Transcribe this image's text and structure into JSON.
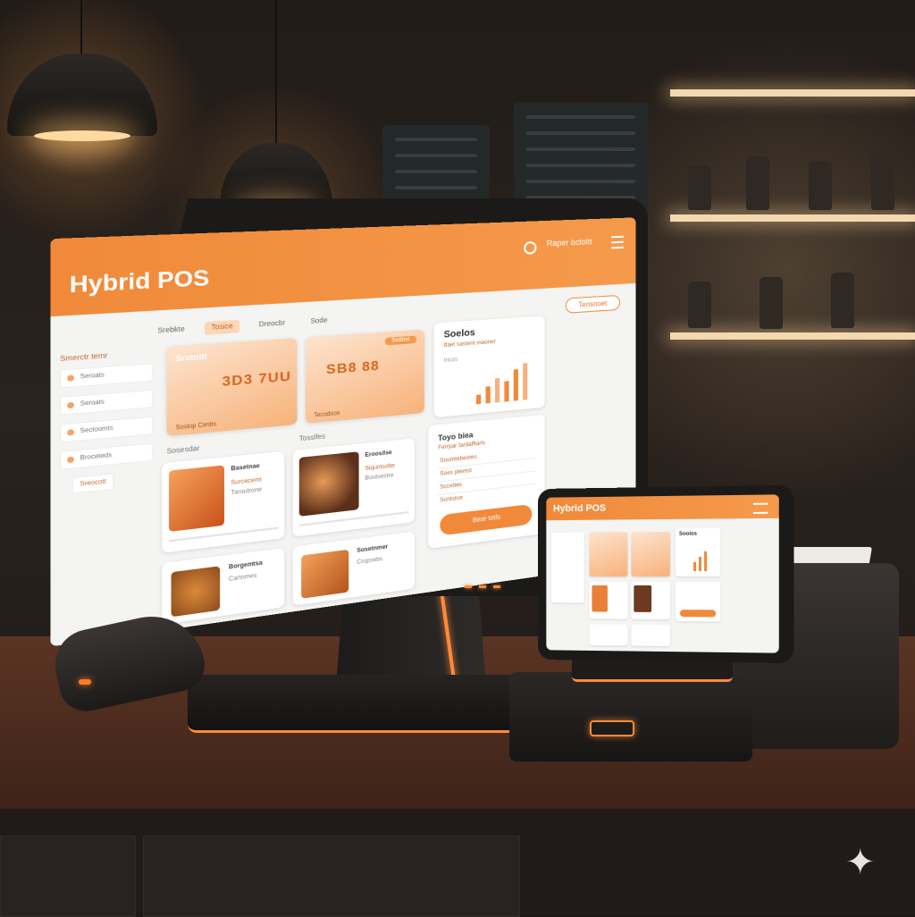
{
  "main_screen": {
    "app_title": "Hybrid POS",
    "header_link": "Raper bctoltt",
    "header_pill": "Tensnoet",
    "tabs": [
      {
        "label": "Srebkte",
        "active": false
      },
      {
        "label": "Tosice",
        "active": true
      },
      {
        "label": "Dreocbr",
        "active": false
      },
      {
        "label": "Sode",
        "active": false
      }
    ],
    "sidebar": {
      "heading": "Smerctr temr",
      "items": [
        "Seroats",
        "Seroats",
        "Sectoomts",
        "Broceteds"
      ],
      "button": "Sreocott"
    },
    "promo_cards": [
      {
        "title": "Srotoitt",
        "glyphs": "3D3 7UU",
        "footer": "Soslop Cimbs",
        "chip": ""
      },
      {
        "title": "",
        "glyphs": "SB8 88",
        "footer": "Tecodsos",
        "chip": "Setlbel"
      }
    ],
    "stats_card": {
      "heading": "Soelos",
      "subtitle": "Ifaet sastent maoner",
      "list_label": "Iricos"
    },
    "sections": [
      "Sosesdar",
      "Tosslfes"
    ],
    "food_cards": [
      {
        "title": "Basetnae",
        "lines": [
          "Surcecemt",
          "Taroutrone"
        ]
      },
      {
        "title": "Eroosilse",
        "lines": [
          "Siquntsobe",
          "Boutsestre"
        ]
      },
      {
        "title": "Borgemtsa",
        "lines": [
          "Cartnmes"
        ]
      },
      {
        "title": "Sosetnmer",
        "lines": [
          "Crupsebs"
        ]
      }
    ],
    "order_card": {
      "heading": "Toyo biea",
      "subtitle": "Ferrpar fardafftarls",
      "rows": [
        "Soumtebeotes",
        "Soes ptemst",
        "Sccettes",
        "Sontstoe"
      ],
      "button": "Bear totls"
    }
  },
  "tablet_screen": {
    "app_title": "Hybrid POS",
    "stats_heading": "Soolos"
  },
  "colors": {
    "accent": "#f08a3a",
    "accent_light": "#fbd7b7",
    "bezel": "#1b1a19",
    "counter": "#4a2a1d"
  },
  "icons": [
    "search-icon",
    "menu-icon",
    "sparkle-icon"
  ]
}
